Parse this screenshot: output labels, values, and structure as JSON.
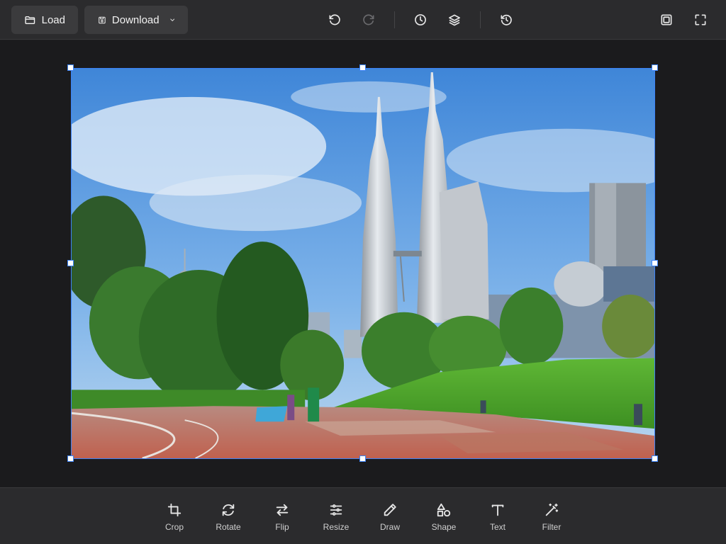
{
  "topbar": {
    "load_label": "Load",
    "download_label": "Download",
    "icons": [
      "folder-icon",
      "save-icon",
      "chevron-down-icon",
      "undo-icon",
      "redo-icon",
      "history-icon",
      "layers-icon",
      "reset-icon",
      "compare-icon",
      "fullscreen-icon"
    ]
  },
  "tools": [
    {
      "label": "Crop",
      "icon": "crop-icon"
    },
    {
      "label": "Rotate",
      "icon": "rotate-icon"
    },
    {
      "label": "Flip",
      "icon": "flip-icon"
    },
    {
      "label": "Resize",
      "icon": "sliders-icon"
    },
    {
      "label": "Draw",
      "icon": "pencil-icon"
    },
    {
      "label": "Shape",
      "icon": "shapes-icon"
    },
    {
      "label": "Text",
      "icon": "text-icon"
    },
    {
      "label": "Filter",
      "icon": "magic-wand-icon"
    }
  ],
  "colors": {
    "background": "#1b1b1d",
    "toolbar": "#2b2b2d",
    "button": "#3b3b3d",
    "selection": "#3c82f6"
  }
}
